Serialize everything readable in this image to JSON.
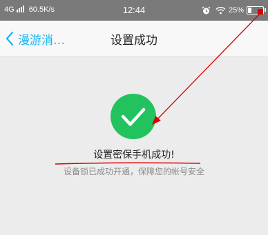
{
  "status_bar": {
    "network": "4G",
    "speed": "60.5K/s",
    "time": "12:44",
    "battery_text": "25%",
    "battery_level": 0.25,
    "icons": [
      "signal-icon",
      "alarm-icon",
      "wifi-icon",
      "battery-icon"
    ]
  },
  "nav": {
    "back_label": "漫游消…",
    "title": "设置成功",
    "accent_color": "#12b7f5"
  },
  "success": {
    "icon": "check-circle-icon",
    "color": "#22c35e",
    "title": "设置密保手机成功!",
    "description": "设备锁已成功开通，保障您的帐号安全"
  },
  "annotations": {
    "color": "#d80000",
    "items": [
      "arrow",
      "underline"
    ]
  }
}
